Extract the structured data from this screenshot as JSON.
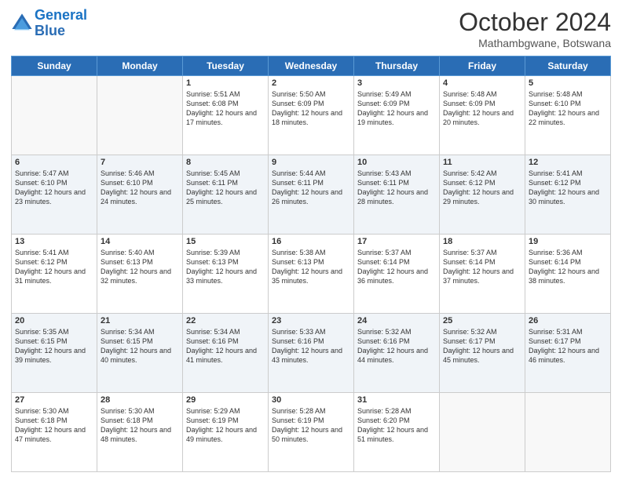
{
  "logo": {
    "line1": "General",
    "line2": "Blue"
  },
  "title": "October 2024",
  "location": "Mathambgwane, Botswana",
  "days_of_week": [
    "Sunday",
    "Monday",
    "Tuesday",
    "Wednesday",
    "Thursday",
    "Friday",
    "Saturday"
  ],
  "weeks": [
    [
      {
        "day": "",
        "sunrise": "",
        "sunset": "",
        "daylight": ""
      },
      {
        "day": "",
        "sunrise": "",
        "sunset": "",
        "daylight": ""
      },
      {
        "day": "1",
        "sunrise": "Sunrise: 5:51 AM",
        "sunset": "Sunset: 6:08 PM",
        "daylight": "Daylight: 12 hours and 17 minutes."
      },
      {
        "day": "2",
        "sunrise": "Sunrise: 5:50 AM",
        "sunset": "Sunset: 6:09 PM",
        "daylight": "Daylight: 12 hours and 18 minutes."
      },
      {
        "day": "3",
        "sunrise": "Sunrise: 5:49 AM",
        "sunset": "Sunset: 6:09 PM",
        "daylight": "Daylight: 12 hours and 19 minutes."
      },
      {
        "day": "4",
        "sunrise": "Sunrise: 5:48 AM",
        "sunset": "Sunset: 6:09 PM",
        "daylight": "Daylight: 12 hours and 20 minutes."
      },
      {
        "day": "5",
        "sunrise": "Sunrise: 5:48 AM",
        "sunset": "Sunset: 6:10 PM",
        "daylight": "Daylight: 12 hours and 22 minutes."
      }
    ],
    [
      {
        "day": "6",
        "sunrise": "Sunrise: 5:47 AM",
        "sunset": "Sunset: 6:10 PM",
        "daylight": "Daylight: 12 hours and 23 minutes."
      },
      {
        "day": "7",
        "sunrise": "Sunrise: 5:46 AM",
        "sunset": "Sunset: 6:10 PM",
        "daylight": "Daylight: 12 hours and 24 minutes."
      },
      {
        "day": "8",
        "sunrise": "Sunrise: 5:45 AM",
        "sunset": "Sunset: 6:11 PM",
        "daylight": "Daylight: 12 hours and 25 minutes."
      },
      {
        "day": "9",
        "sunrise": "Sunrise: 5:44 AM",
        "sunset": "Sunset: 6:11 PM",
        "daylight": "Daylight: 12 hours and 26 minutes."
      },
      {
        "day": "10",
        "sunrise": "Sunrise: 5:43 AM",
        "sunset": "Sunset: 6:11 PM",
        "daylight": "Daylight: 12 hours and 28 minutes."
      },
      {
        "day": "11",
        "sunrise": "Sunrise: 5:42 AM",
        "sunset": "Sunset: 6:12 PM",
        "daylight": "Daylight: 12 hours and 29 minutes."
      },
      {
        "day": "12",
        "sunrise": "Sunrise: 5:41 AM",
        "sunset": "Sunset: 6:12 PM",
        "daylight": "Daylight: 12 hours and 30 minutes."
      }
    ],
    [
      {
        "day": "13",
        "sunrise": "Sunrise: 5:41 AM",
        "sunset": "Sunset: 6:12 PM",
        "daylight": "Daylight: 12 hours and 31 minutes."
      },
      {
        "day": "14",
        "sunrise": "Sunrise: 5:40 AM",
        "sunset": "Sunset: 6:13 PM",
        "daylight": "Daylight: 12 hours and 32 minutes."
      },
      {
        "day": "15",
        "sunrise": "Sunrise: 5:39 AM",
        "sunset": "Sunset: 6:13 PM",
        "daylight": "Daylight: 12 hours and 33 minutes."
      },
      {
        "day": "16",
        "sunrise": "Sunrise: 5:38 AM",
        "sunset": "Sunset: 6:13 PM",
        "daylight": "Daylight: 12 hours and 35 minutes."
      },
      {
        "day": "17",
        "sunrise": "Sunrise: 5:37 AM",
        "sunset": "Sunset: 6:14 PM",
        "daylight": "Daylight: 12 hours and 36 minutes."
      },
      {
        "day": "18",
        "sunrise": "Sunrise: 5:37 AM",
        "sunset": "Sunset: 6:14 PM",
        "daylight": "Daylight: 12 hours and 37 minutes."
      },
      {
        "day": "19",
        "sunrise": "Sunrise: 5:36 AM",
        "sunset": "Sunset: 6:14 PM",
        "daylight": "Daylight: 12 hours and 38 minutes."
      }
    ],
    [
      {
        "day": "20",
        "sunrise": "Sunrise: 5:35 AM",
        "sunset": "Sunset: 6:15 PM",
        "daylight": "Daylight: 12 hours and 39 minutes."
      },
      {
        "day": "21",
        "sunrise": "Sunrise: 5:34 AM",
        "sunset": "Sunset: 6:15 PM",
        "daylight": "Daylight: 12 hours and 40 minutes."
      },
      {
        "day": "22",
        "sunrise": "Sunrise: 5:34 AM",
        "sunset": "Sunset: 6:16 PM",
        "daylight": "Daylight: 12 hours and 41 minutes."
      },
      {
        "day": "23",
        "sunrise": "Sunrise: 5:33 AM",
        "sunset": "Sunset: 6:16 PM",
        "daylight": "Daylight: 12 hours and 43 minutes."
      },
      {
        "day": "24",
        "sunrise": "Sunrise: 5:32 AM",
        "sunset": "Sunset: 6:16 PM",
        "daylight": "Daylight: 12 hours and 44 minutes."
      },
      {
        "day": "25",
        "sunrise": "Sunrise: 5:32 AM",
        "sunset": "Sunset: 6:17 PM",
        "daylight": "Daylight: 12 hours and 45 minutes."
      },
      {
        "day": "26",
        "sunrise": "Sunrise: 5:31 AM",
        "sunset": "Sunset: 6:17 PM",
        "daylight": "Daylight: 12 hours and 46 minutes."
      }
    ],
    [
      {
        "day": "27",
        "sunrise": "Sunrise: 5:30 AM",
        "sunset": "Sunset: 6:18 PM",
        "daylight": "Daylight: 12 hours and 47 minutes."
      },
      {
        "day": "28",
        "sunrise": "Sunrise: 5:30 AM",
        "sunset": "Sunset: 6:18 PM",
        "daylight": "Daylight: 12 hours and 48 minutes."
      },
      {
        "day": "29",
        "sunrise": "Sunrise: 5:29 AM",
        "sunset": "Sunset: 6:19 PM",
        "daylight": "Daylight: 12 hours and 49 minutes."
      },
      {
        "day": "30",
        "sunrise": "Sunrise: 5:28 AM",
        "sunset": "Sunset: 6:19 PM",
        "daylight": "Daylight: 12 hours and 50 minutes."
      },
      {
        "day": "31",
        "sunrise": "Sunrise: 5:28 AM",
        "sunset": "Sunset: 6:20 PM",
        "daylight": "Daylight: 12 hours and 51 minutes."
      },
      {
        "day": "",
        "sunrise": "",
        "sunset": "",
        "daylight": ""
      },
      {
        "day": "",
        "sunrise": "",
        "sunset": "",
        "daylight": ""
      }
    ]
  ]
}
